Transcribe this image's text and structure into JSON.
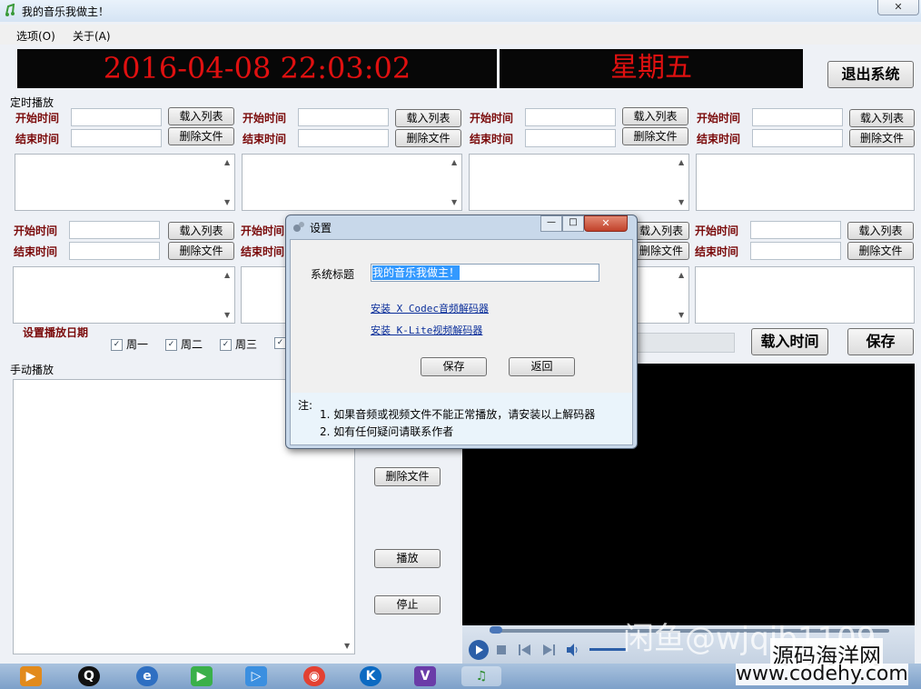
{
  "window": {
    "title": "我的音乐我做主！",
    "close_glyph": "✕"
  },
  "menu": [
    {
      "label": "选项(O)"
    },
    {
      "label": "关于(A)"
    }
  ],
  "clock": {
    "datetime": "2016-04-08  22:03:02",
    "weekday": "星期五",
    "color": "#e01010"
  },
  "exit_button": "退出系统",
  "schedule": {
    "section_label": "定时播放",
    "start_label": "开始时间",
    "end_label": "结束时间",
    "load_list_button": "载入列表",
    "delete_file_button": "删除文件",
    "date_label": "设置播放日期",
    "weekdays": [
      "周一",
      "周二",
      "周三"
    ],
    "load_time_button": "载入时间",
    "save_button": "保存"
  },
  "manual": {
    "section_label": "手动播放",
    "delete_file_button": "删除文件",
    "play_button": "播放",
    "stop_button": "停止"
  },
  "dialog": {
    "title": "设置",
    "system_title_label": "系统标题",
    "system_title_value": "我的音乐我做主！",
    "link_xcodec": "安装 X Codec音频解码器",
    "link_klite": "安装 K-Lite视频解码器",
    "save_button": "保存",
    "back_button": "返回",
    "note_label": "注:",
    "note_1": "1. 如果音频或视频文件不能正常播放，请安装以上解码器",
    "note_2": "2. 如有任何疑问请联系作者"
  },
  "watermark": {
    "line1": "闲鱼@wjqib1109",
    "line2": "源码海洋网",
    "line3": "www.codehy.com"
  },
  "icons": [
    "app-music-icon",
    "close-icon",
    "play-icon",
    "stop-icon",
    "prev-icon",
    "next-icon",
    "volume-icon",
    "qq-icon",
    "chrome-icon",
    "visual-studio-icon"
  ]
}
